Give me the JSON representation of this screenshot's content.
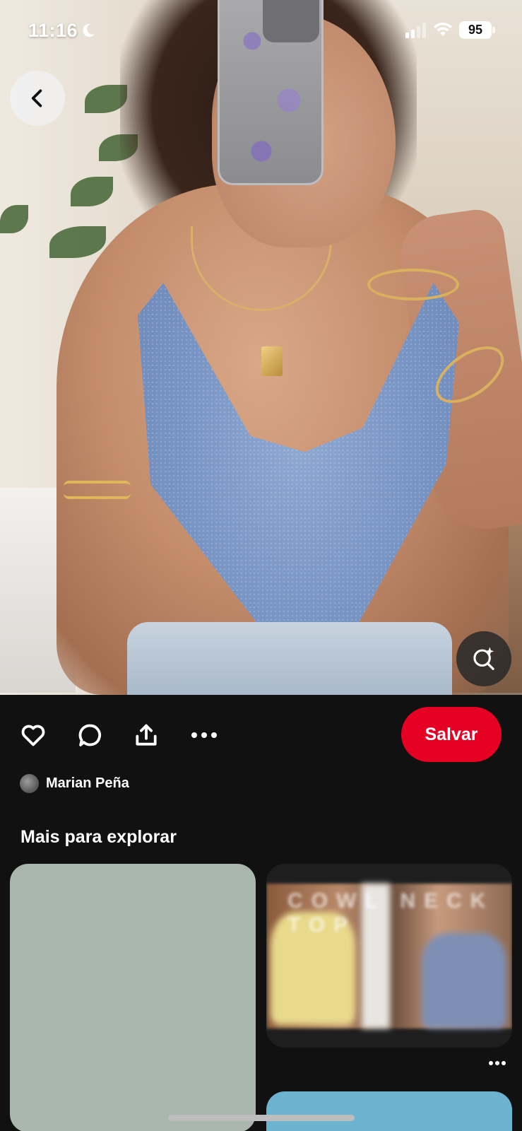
{
  "status_bar": {
    "time": "11:16",
    "battery": "95",
    "icons": [
      "moon-icon",
      "signal-icon",
      "wifi-icon",
      "battery-icon"
    ]
  },
  "pin": {
    "image_alt": "",
    "back_icon": "chevron-left-icon",
    "visual_search_icon": "magnifier-sparkle-icon"
  },
  "actions": {
    "icons": [
      "heart-icon",
      "comment-icon",
      "share-icon",
      "more-icon"
    ],
    "save_label": "Salvar"
  },
  "author": {
    "name": "Marian Peña"
  },
  "explore": {
    "title": "Mais para explorar",
    "cards": [
      {
        "kind": "image",
        "color": "#a8b6ae"
      },
      {
        "kind": "image",
        "overlay_text": "COWL NECK TOP",
        "more_icon": "more-icon"
      },
      {
        "kind": "image",
        "color": "#6bb3cf"
      }
    ]
  },
  "colors": {
    "save_button": "#e60023",
    "background": "#111111",
    "text": "#ffffff"
  }
}
